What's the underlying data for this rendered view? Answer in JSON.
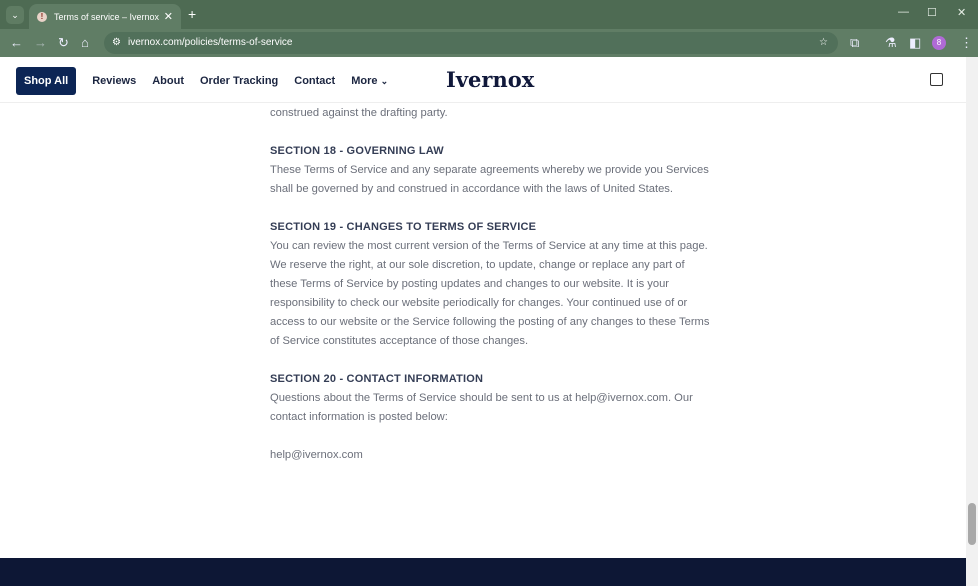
{
  "browser": {
    "tab_title": "Terms of service – Ivernox",
    "url": "ivernox.com/policies/terms-of-service",
    "avatar": "8"
  },
  "nav": {
    "items": [
      "Shop All",
      "Reviews",
      "About",
      "Order Tracking",
      "Contact",
      "More"
    ],
    "logo": "Ivernox"
  },
  "content": {
    "intro": "construed against the drafting party.",
    "sections": [
      {
        "title": "SECTION 18 - GOVERNING LAW",
        "paras": [
          "These Terms of Service and any separate agreements whereby we provide you Services shall be governed by and construed in accordance with the laws of United States."
        ]
      },
      {
        "title": "SECTION 19 - CHANGES TO TERMS OF SERVICE",
        "paras": [
          "You can review the most current version of the Terms of Service at any time at this page.",
          "We reserve the right, at our sole discretion, to update, change or replace any part of these Terms of Service by posting updates and changes to our website. It is your responsibility to check our website periodically for changes. Your continued use of or access to our website or the Service following the posting of any changes to these Terms of Service constitutes acceptance of those changes."
        ]
      },
      {
        "title": "SECTION 20 - CONTACT INFORMATION",
        "paras": [
          "Questions about the Terms of Service should be sent to us at help@ivernox.com. Our contact information is posted below:"
        ]
      }
    ],
    "email": "help@ivernox.com"
  }
}
